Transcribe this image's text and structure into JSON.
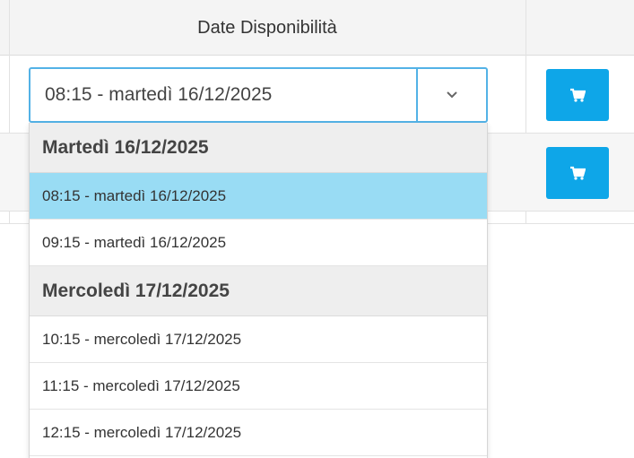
{
  "table": {
    "header_title": "Date Disponibilità"
  },
  "select": {
    "value": "08:15 - martedì 16/12/2025",
    "arrow_icon": "chevron-down-icon",
    "border_color": "#53b2e6"
  },
  "cart_buttons": [
    {
      "icon": "cart-icon"
    },
    {
      "icon": "cart-icon"
    }
  ],
  "accent_color": "#0ea6e8",
  "dropdown": {
    "groups": [
      {
        "label": "Martedì 16/12/2025",
        "options": [
          {
            "label": "08:15 - martedì 16/12/2025",
            "selected": true
          },
          {
            "label": "09:15 - martedì 16/12/2025",
            "selected": false
          }
        ]
      },
      {
        "label": "Mercoledì 17/12/2025",
        "options": [
          {
            "label": "10:15 - mercoledì 17/12/2025",
            "selected": false
          },
          {
            "label": "11:15 - mercoledì 17/12/2025",
            "selected": false
          },
          {
            "label": "12:15 - mercoledì 17/12/2025",
            "selected": false
          }
        ]
      }
    ],
    "selected_color": "#99dcf4"
  }
}
